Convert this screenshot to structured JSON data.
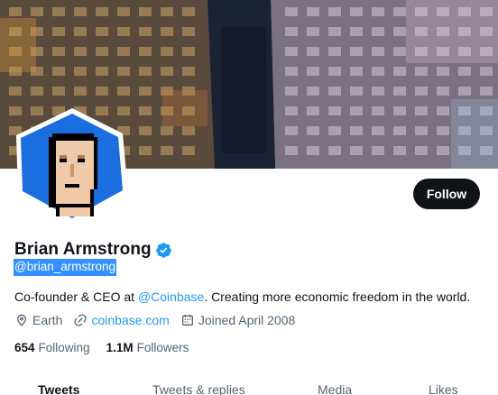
{
  "profile": {
    "name": "Brian Armstrong",
    "handle": "@brian_armstrong",
    "bio_prefix": "Co-founder & CEO at ",
    "bio_mention": "@Coinbase",
    "bio_suffix": ". Creating more economic freedom in the world.",
    "location": "Earth",
    "website": "coinbase.com",
    "joined": "Joined April 2008",
    "following_count": "654",
    "following_label": "Following",
    "followers_count": "1.1M",
    "followers_label": "Followers",
    "verified": true
  },
  "actions": {
    "follow_label": "Follow"
  },
  "tabs": [
    {
      "label": "Tweets",
      "active": true
    },
    {
      "label": "Tweets & replies",
      "active": false
    },
    {
      "label": "Media",
      "active": false
    },
    {
      "label": "Likes",
      "active": false
    }
  ],
  "icons": {
    "location": "location-pin-icon",
    "link": "link-icon",
    "calendar": "calendar-icon",
    "verified": "verified-badge-icon"
  },
  "colors": {
    "accent": "#1d9bf0",
    "text_primary": "#0f1419",
    "text_secondary": "#536471",
    "follow_button": "#0f1419",
    "avatar_background": "#1a6ee0",
    "selection_highlight": "#3390ff"
  }
}
